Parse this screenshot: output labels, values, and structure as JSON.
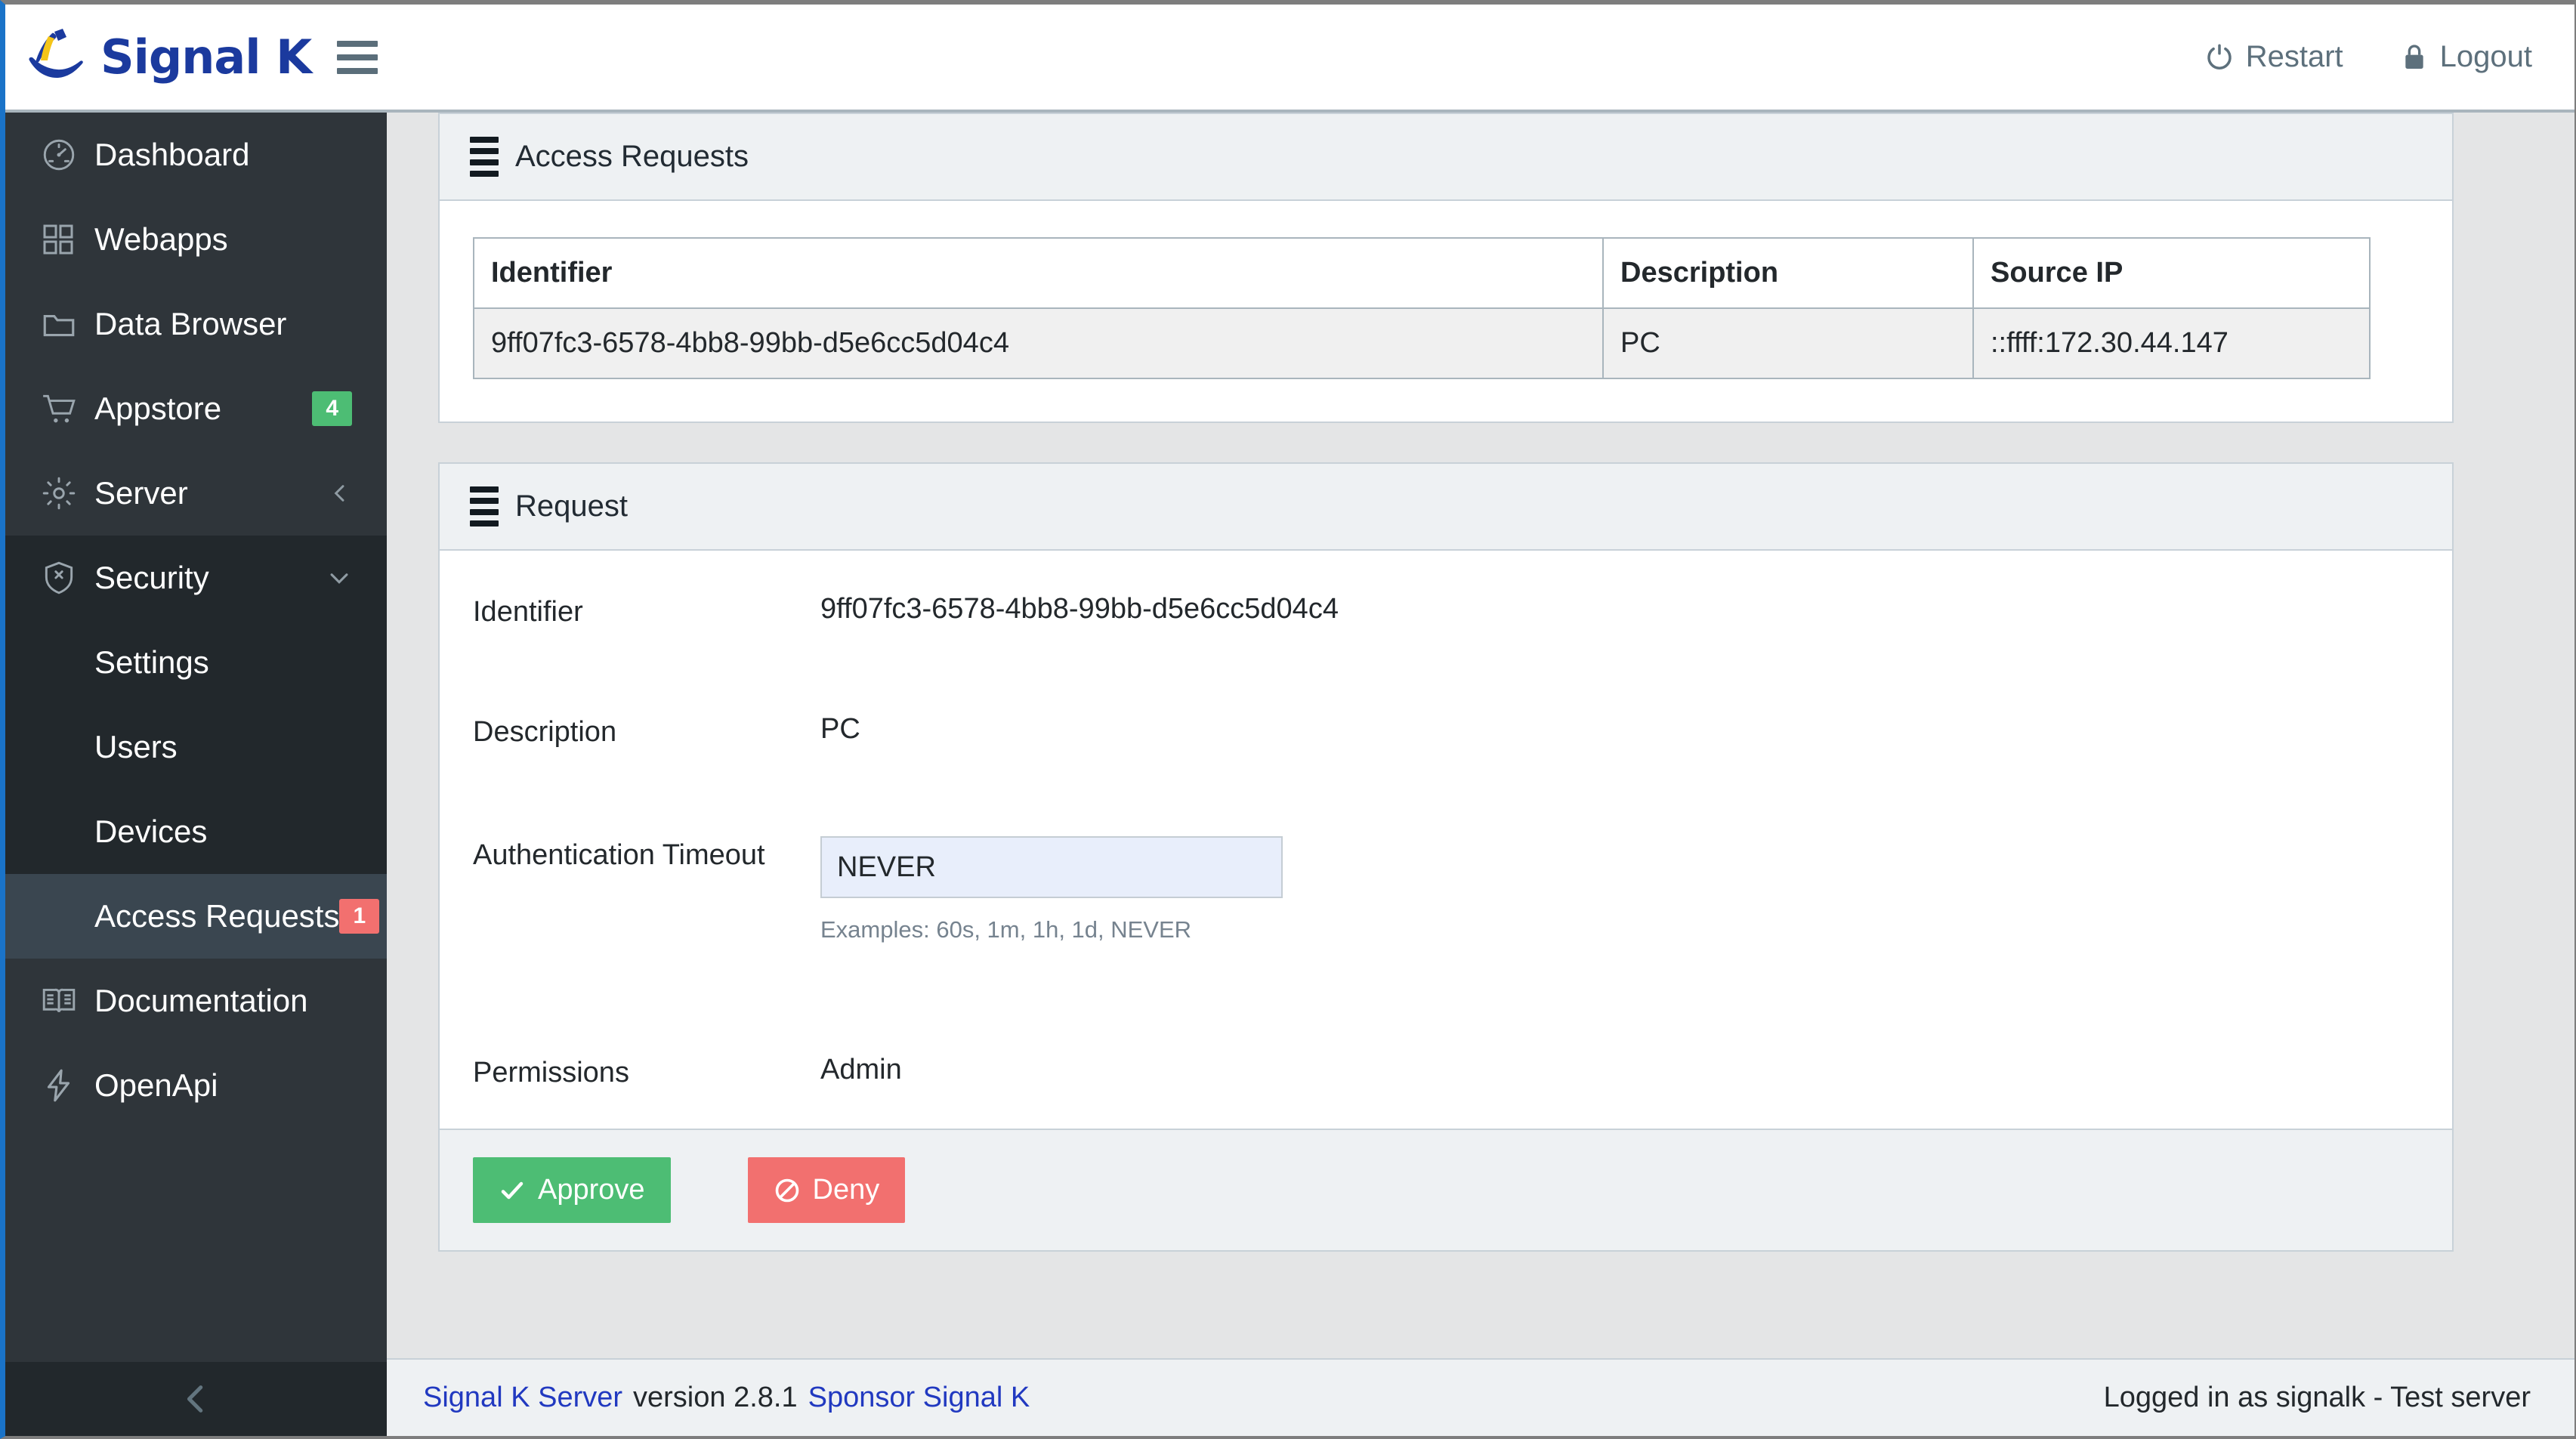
{
  "header": {
    "brand": "Signal K",
    "logo_icon": "signalk-boat-logo",
    "menu_icon": "hamburger-menu-icon",
    "restart_label": "Restart",
    "restart_icon": "power-circle-icon",
    "logout_label": "Logout",
    "logout_icon": "lock-icon",
    "accent": "#1b3a9e"
  },
  "sidebar": {
    "items": [
      {
        "label": "Dashboard",
        "icon": "speedometer-icon"
      },
      {
        "label": "Webapps",
        "icon": "grid-icon"
      },
      {
        "label": "Data Browser",
        "icon": "folder-icon"
      },
      {
        "label": "Appstore",
        "icon": "cart-icon",
        "badge": "4",
        "badge_color": "#4dbd74"
      },
      {
        "label": "Server",
        "icon": "gear-icon",
        "chevron": "chevron-left-icon"
      },
      {
        "label": "Security",
        "icon": "shield-x-icon",
        "chevron": "chevron-down-icon"
      }
    ],
    "security_children": [
      {
        "label": "Settings"
      },
      {
        "label": "Users"
      },
      {
        "label": "Devices"
      },
      {
        "label": "Access Requests",
        "badge": "1",
        "badge_color": "#f2706f",
        "active": true
      }
    ],
    "items_after": [
      {
        "label": "Documentation",
        "icon": "book-icon"
      },
      {
        "label": "OpenApi",
        "icon": "bolt-icon"
      }
    ],
    "minimizer_icon": "chevron-left-icon"
  },
  "access_requests_card": {
    "title": "Access Requests",
    "title_icon": "align-justify-icon",
    "columns": [
      "Identifier",
      "Description",
      "Source IP"
    ],
    "rows": [
      {
        "identifier": "9ff07fc3-6578-4bb8-99bb-d5e6cc5d04c4",
        "description": "PC",
        "source_ip": "::ffff:172.30.44.147"
      }
    ]
  },
  "request_card": {
    "title": "Request",
    "title_icon": "align-justify-icon",
    "fields": {
      "identifier_label": "Identifier",
      "identifier_value": "9ff07fc3-6578-4bb8-99bb-d5e6cc5d04c4",
      "description_label": "Description",
      "description_value": "PC",
      "timeout_label": "Authentication Timeout",
      "timeout_value": "NEVER",
      "timeout_placeholder": "NEVER",
      "timeout_help": "Examples: 60s, 1m, 1h, 1d, NEVER",
      "permissions_label": "Permissions",
      "permissions_value": "Admin"
    },
    "approve_label": "Approve",
    "approve_icon": "check-icon",
    "approve_color": "#4dbd74",
    "deny_label": "Deny",
    "deny_icon": "ban-icon",
    "deny_color": "#f2706f"
  },
  "footer": {
    "server_link": "Signal K Server",
    "version": "version 2.8.1",
    "sponsor_link": "Sponsor Signal K",
    "status": "Logged in as signalk - Test server"
  }
}
